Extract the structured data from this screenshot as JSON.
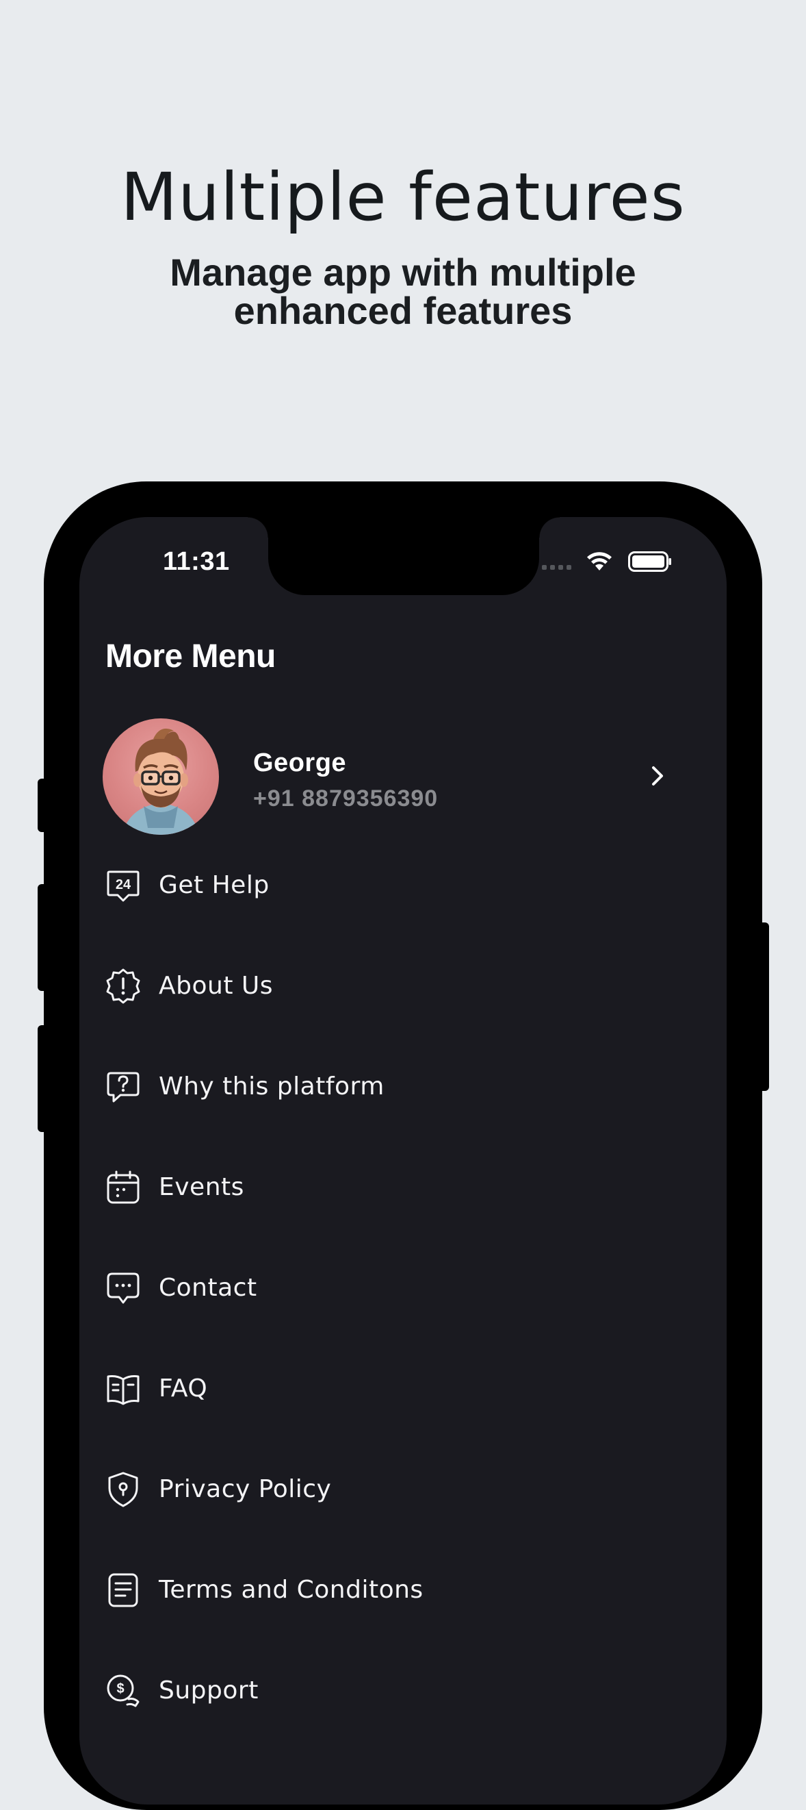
{
  "promo": {
    "headline": "Multiple features",
    "subheadline": "Manage app with multiple enhanced features"
  },
  "status_bar": {
    "time": "11:31"
  },
  "screen": {
    "title": "More Menu"
  },
  "profile": {
    "name": "George",
    "phone": "+91 8879356390"
  },
  "menu": {
    "items": [
      {
        "label": "Get Help",
        "icon": "24-hour-support-icon"
      },
      {
        "label": "About Us",
        "icon": "info-badge-icon"
      },
      {
        "label": "Why this platform",
        "icon": "question-chat-icon"
      },
      {
        "label": "Events",
        "icon": "calendar-icon"
      },
      {
        "label": "Contact",
        "icon": "chat-bubble-icon"
      },
      {
        "label": "FAQ",
        "icon": "book-icon"
      },
      {
        "label": "Privacy Policy",
        "icon": "shield-icon"
      },
      {
        "label": "Terms and Conditons",
        "icon": "document-icon"
      },
      {
        "label": "Support",
        "icon": "money-support-icon"
      }
    ]
  }
}
